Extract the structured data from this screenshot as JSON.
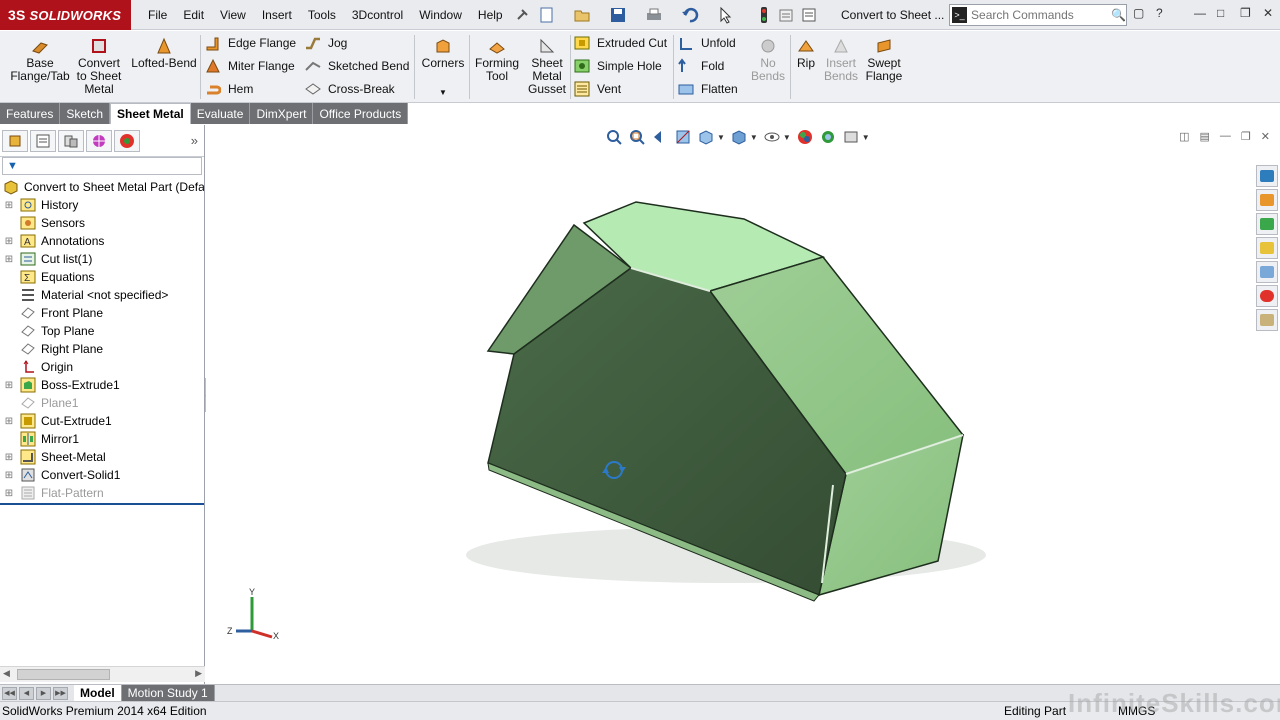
{
  "app": {
    "logo_prefix": "3S",
    "logo_text": "SOLIDWORKS",
    "menus": [
      "File",
      "Edit",
      "View",
      "Insert",
      "Tools",
      "3Dcontrol",
      "Window",
      "Help"
    ],
    "doc_title": "Convert to Sheet ...",
    "search_placeholder": "Search Commands"
  },
  "ribbon": {
    "base_flange": "Base\nFlange/Tab",
    "convert": "Convert\nto Sheet\nMetal",
    "lofted": "Lofted-Bend",
    "edge_flange": "Edge Flange",
    "miter_flange": "Miter Flange",
    "hem": "Hem",
    "jog": "Jog",
    "sketched_bend": "Sketched Bend",
    "cross_break": "Cross-Break",
    "corners": "Corners",
    "forming_tool": "Forming\nTool",
    "gusset": "Sheet\nMetal\nGusset",
    "extruded_cut": "Extruded Cut",
    "simple_hole": "Simple Hole",
    "vent": "Vent",
    "unfold": "Unfold",
    "fold": "Fold",
    "flatten": "Flatten",
    "no_bends": "No\nBends",
    "rip": "Rip",
    "insert_bends": "Insert\nBends",
    "swept_flange": "Swept\nFlange"
  },
  "tabs": [
    "Features",
    "Sketch",
    "Sheet Metal",
    "Evaluate",
    "DimXpert",
    "Office Products"
  ],
  "active_tab": "Sheet Metal",
  "tree": {
    "root": "Convert to Sheet Metal Part  (Defa",
    "items": [
      {
        "label": "History",
        "icon": "history-icon"
      },
      {
        "label": "Sensors",
        "icon": "sensors-icon"
      },
      {
        "label": "Annotations",
        "icon": "annotations-icon"
      },
      {
        "label": "Cut list(1)",
        "icon": "cut-list-icon"
      },
      {
        "label": "Equations",
        "icon": "equations-icon"
      },
      {
        "label": "Material <not specified>",
        "icon": "material-icon"
      },
      {
        "label": "Front Plane",
        "icon": "plane-icon"
      },
      {
        "label": "Top Plane",
        "icon": "plane-icon"
      },
      {
        "label": "Right Plane",
        "icon": "plane-icon"
      },
      {
        "label": "Origin",
        "icon": "origin-icon"
      },
      {
        "label": "Boss-Extrude1",
        "icon": "extrude-icon"
      },
      {
        "label": "Plane1",
        "icon": "plane-icon"
      },
      {
        "label": "Cut-Extrude1",
        "icon": "cut-extrude-icon"
      },
      {
        "label": "Mirror1",
        "icon": "mirror-icon"
      },
      {
        "label": "Sheet-Metal",
        "icon": "sheet-metal-icon"
      },
      {
        "label": "Convert-Solid1",
        "icon": "convert-solid-icon"
      },
      {
        "label": "Flat-Pattern",
        "icon": "flat-pattern-icon"
      }
    ]
  },
  "triad": {
    "x": "X",
    "y": "Y",
    "z": "Z"
  },
  "bottom_tabs": [
    "Model",
    "Motion Study 1"
  ],
  "status": {
    "edition": "SolidWorks Premium 2014 x64 Edition",
    "mode": "Editing Part",
    "units": "MMGS"
  },
  "watermark": "InfiniteSkills.com",
  "colors": {
    "brand": "#b0121b",
    "part_face_light": "#b6eab3",
    "part_face_dark": "#3e5a3e"
  }
}
